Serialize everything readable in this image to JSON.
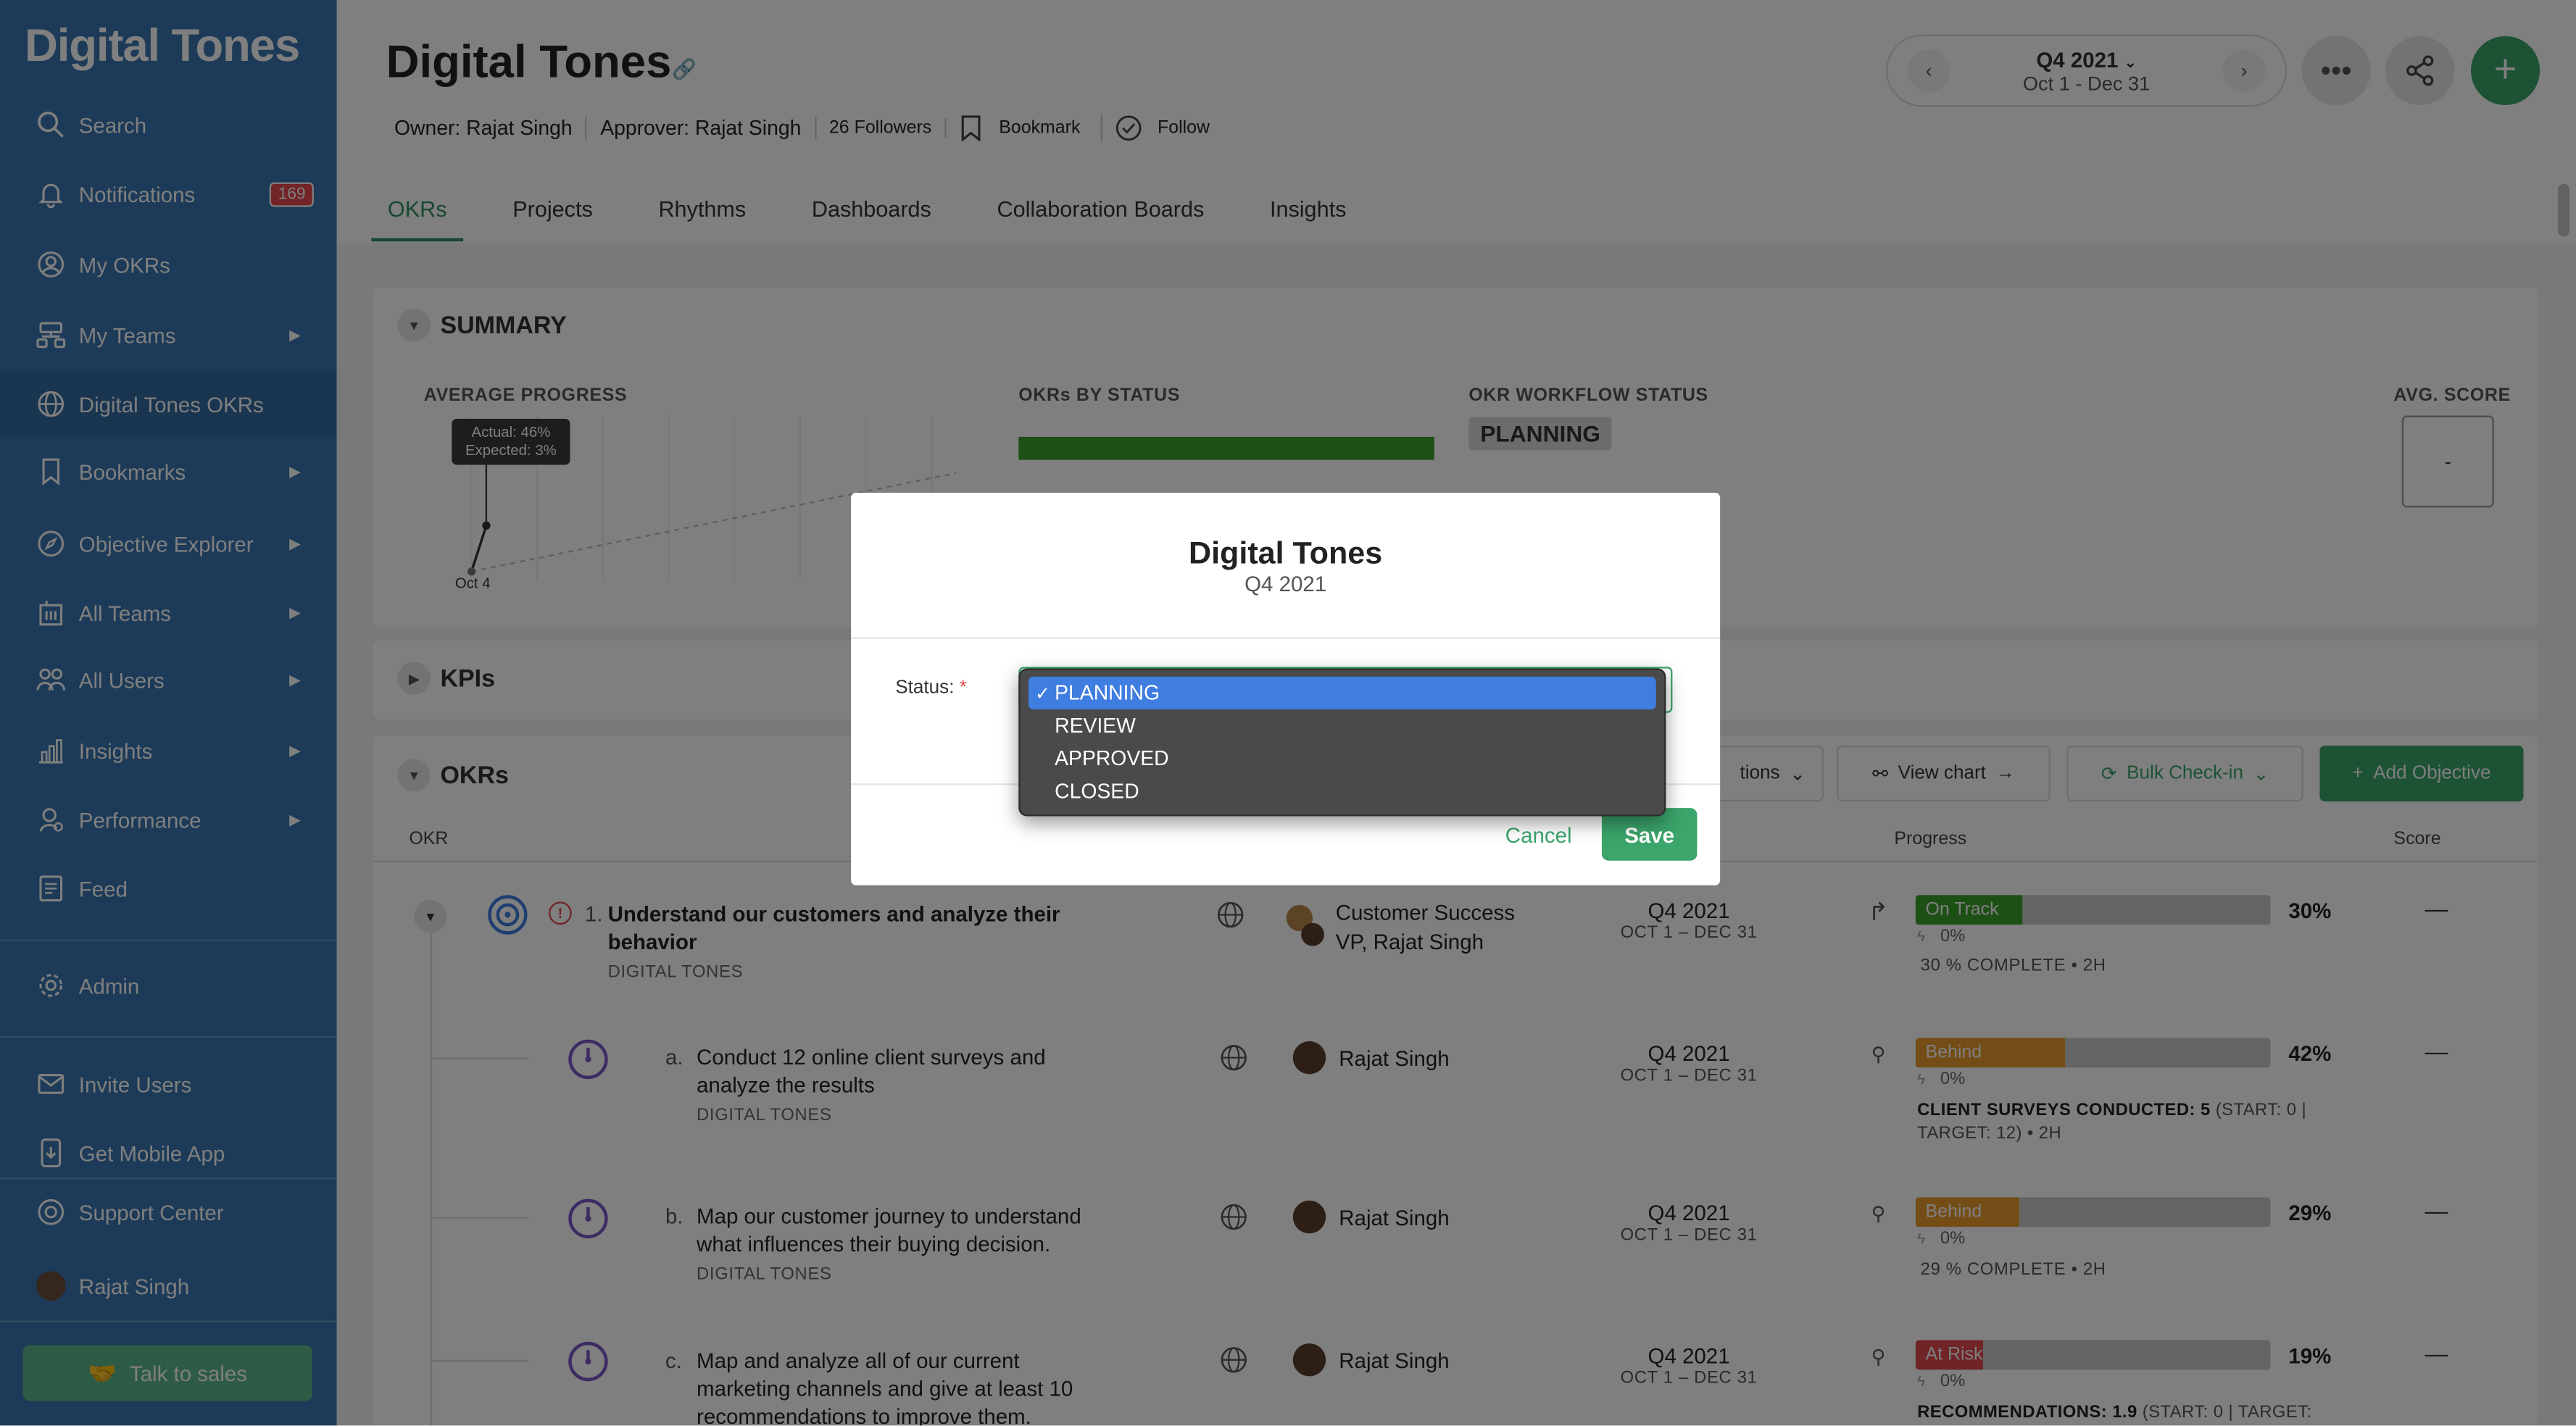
{
  "app": {
    "logo": "Digital Tones"
  },
  "sidebar": {
    "items": [
      {
        "label": "Search"
      },
      {
        "label": "Notifications",
        "badge": "169"
      },
      {
        "label": "My OKRs"
      },
      {
        "label": "My Teams"
      },
      {
        "label": "Digital Tones OKRs"
      },
      {
        "label": "Bookmarks"
      },
      {
        "label": "Objective Explorer"
      },
      {
        "label": "All Teams"
      },
      {
        "label": "All Users"
      },
      {
        "label": "Insights"
      },
      {
        "label": "Performance"
      },
      {
        "label": "Feed"
      },
      {
        "label": "Admin"
      },
      {
        "label": "Invite Users"
      },
      {
        "label": "Get Mobile App"
      },
      {
        "label": "Support Center"
      },
      {
        "label": "Rajat Singh"
      }
    ],
    "talk_to_sales": "Talk to sales"
  },
  "header": {
    "title": "Digital Tones",
    "owner": "Owner: Rajat Singh",
    "approver": "Approver: Rajat Singh",
    "followers": "26 Followers",
    "bookmark": "Bookmark",
    "follow": "Follow",
    "period_quarter": "Q4 2021",
    "period_range": "Oct 1 - Dec 31"
  },
  "tabs": [
    "OKRs",
    "Projects",
    "Rhythms",
    "Dashboards",
    "Collaboration Boards",
    "Insights"
  ],
  "summary": {
    "title": "SUMMARY",
    "avg_progress_label": "AVERAGE PROGRESS",
    "tooltip_actual": "Actual: 46%",
    "tooltip_expected": "Expected: 3%",
    "date_tick": "Oct 4",
    "okrs_by_status_label": "OKRs BY STATUS",
    "workflow_label": "OKR WORKFLOW STATUS",
    "workflow_value": "PLANNING",
    "avg_score_label": "AVG. SCORE",
    "avg_score_value": "-"
  },
  "kpis": {
    "title": "KPIs"
  },
  "okrs": {
    "title": "OKRs",
    "col_okr": "OKR",
    "col_progress": "Progress",
    "col_score": "Score",
    "actions_partial": "tions",
    "view_chart": "View chart",
    "bulk_checkin": "Bulk Check-in",
    "add_objective": "Add Objective",
    "rows": [
      {
        "num": "1.",
        "title_1": "Understand our customers and analyze their",
        "title_2": "behavior",
        "team": "DIGITAL TONES",
        "owner_1": "Customer Success",
        "owner_2": "VP, Rajat Singh",
        "q": "Q4 2021",
        "range": "OCT 1 – DEC 31",
        "status": "On Track",
        "pct": "30%",
        "sub_pct": "0%",
        "detail": "30 % COMPLETE • 2H",
        "score": "—",
        "progress": 0.3
      },
      {
        "num": "a.",
        "title_1": "Conduct 12 online client surveys and",
        "title_2": "analyze the results",
        "team": "DIGITAL TONES",
        "owner_1": "Rajat Singh",
        "q": "Q4 2021",
        "range": "OCT 1 – DEC 31",
        "status": "Behind",
        "pct": "42%",
        "sub_pct": "0%",
        "detail_bold": "CLIENT SURVEYS CONDUCTED:",
        "detail_val": "5",
        "detail_rest": "(START: 0 |",
        "detail_2": "TARGET: 12) • 2H",
        "score": "—",
        "progress": 0.42
      },
      {
        "num": "b.",
        "title_1": "Map our customer journey to understand",
        "title_2": "what influences their buying decision.",
        "team": "DIGITAL TONES",
        "owner_1": "Rajat Singh",
        "q": "Q4 2021",
        "range": "OCT 1 – DEC 31",
        "status": "Behind",
        "pct": "29%",
        "sub_pct": "0%",
        "detail": "29 % COMPLETE • 2H",
        "score": "—",
        "progress": 0.29
      },
      {
        "num": "c.",
        "title_1": "Map and analyze all of our current",
        "title_2": "marketing channels and give at least 10",
        "title_3": "recommendations to improve them.",
        "owner_1": "Rajat Singh",
        "q": "Q4 2021",
        "range": "OCT 1 – DEC 31",
        "status": "At Risk",
        "pct": "19%",
        "sub_pct": "0%",
        "detail_bold": "RECOMMENDATIONS:",
        "detail_val": "1.9",
        "detail_rest": "(START: 0 | TARGET:",
        "score": "—",
        "progress": 0.19
      }
    ]
  },
  "modal": {
    "title": "Digital Tones",
    "subtitle": "Q4 2021",
    "status_label": "Status:",
    "required": "*",
    "options": [
      "PLANNING",
      "REVIEW",
      "APPROVED",
      "CLOSED"
    ],
    "selected": "PLANNING",
    "cancel": "Cancel",
    "save": "Save"
  },
  "colors": {
    "sidebar": "#3a77b0",
    "accent": "#3ba56b",
    "on_track": "#3ba02a",
    "behind": "#e89a2c",
    "at_risk": "#e0484d",
    "dropdown_highlight": "#3f7de0"
  }
}
